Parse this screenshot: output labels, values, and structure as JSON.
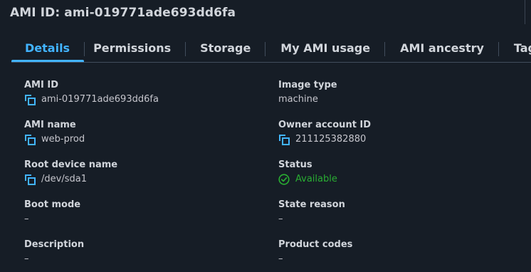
{
  "header": {
    "title": "AMI ID: ami-019771ade693dd6fa"
  },
  "tabs": [
    {
      "label": "Details",
      "active": true
    },
    {
      "label": "Permissions",
      "active": false
    },
    {
      "label": "Storage",
      "active": false
    },
    {
      "label": "My AMI usage",
      "active": false
    },
    {
      "label": "AMI ancestry",
      "active": false
    },
    {
      "label": "Tags",
      "active": false
    }
  ],
  "details": {
    "ami_id": {
      "label": "AMI ID",
      "value": "ami-019771ade693dd6fa",
      "icon": "copy-icon"
    },
    "ami_name": {
      "label": "AMI name",
      "value": "web-prod",
      "icon": "copy-icon"
    },
    "root_device_name": {
      "label": "Root device name",
      "value": "/dev/sda1",
      "icon": "copy-icon"
    },
    "boot_mode": {
      "label": "Boot mode",
      "value": "–"
    },
    "description": {
      "label": "Description",
      "value": "–"
    },
    "image_type": {
      "label": "Image type",
      "value": "machine"
    },
    "owner_account_id": {
      "label": "Owner account ID",
      "value": "211125382880",
      "icon": "copy-icon"
    },
    "status": {
      "label": "Status",
      "value": "Available",
      "icon": "check-circle-icon",
      "color": "#29ad32"
    },
    "state_reason": {
      "label": "State reason",
      "value": "–"
    },
    "product_codes": {
      "label": "Product codes",
      "value": "–"
    }
  },
  "colors": {
    "background": "#161d26",
    "accent": "#42b4ff",
    "text": "#d1d5db",
    "success": "#29ad32",
    "divider": "#414d5c"
  }
}
